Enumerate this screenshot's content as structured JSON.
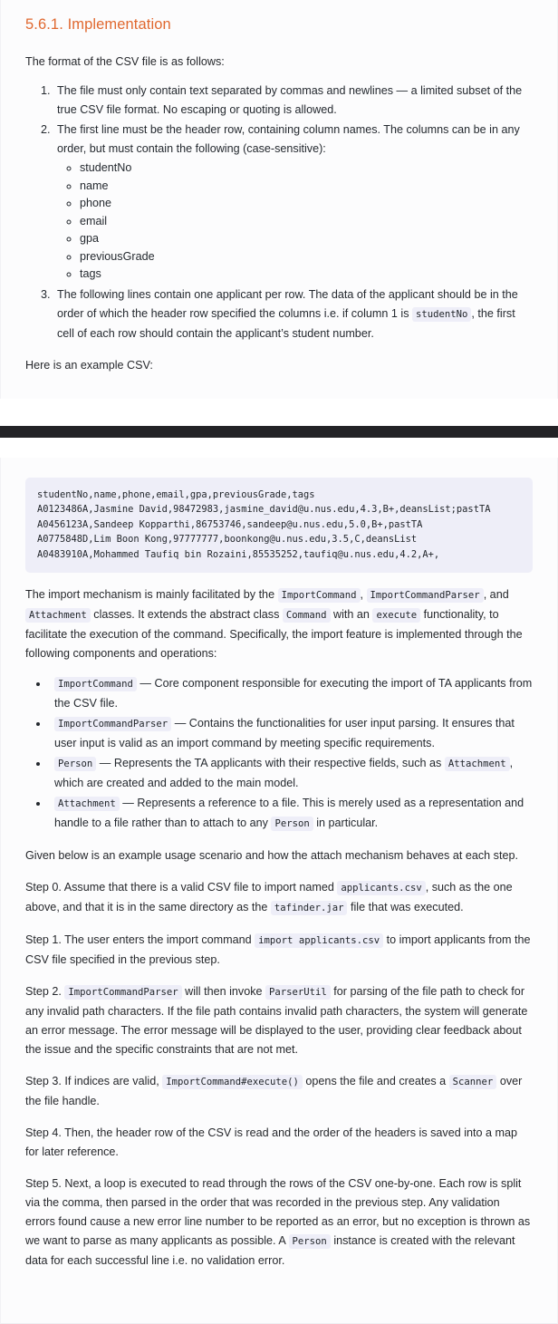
{
  "heading": "5.6.1. Implementation",
  "intro": "The format of the CSV file is as follows:",
  "rules": {
    "rule1": "The file must only contain text separated by commas and newlines — a limited subset of the true CSV file format. No escaping or quoting is allowed.",
    "rule2_lead": "The first line must be the header row, containing column names. The columns can be in any order, but must contain the following (case-sensitive):",
    "columns": [
      "studentNo",
      "name",
      "phone",
      "email",
      "gpa",
      "previousGrade",
      "tags"
    ],
    "rule3_a": "The following lines contain one applicant per row. The data of the applicant should be in the order of which the header row specified the columns i.e. if column 1 is",
    "rule3_code": "studentNo",
    "rule3_b": ", the first cell of each row should contain the applicant’s student number."
  },
  "example_lead": "Here is an example CSV:",
  "csv": {
    "line0": "studentNo,name,phone,email,gpa,previousGrade,tags",
    "line1": "A0123486A,Jasmine David,98472983,jasmine_david@u.nus.edu,4.3,B+,deansList;pastTA",
    "line2": "A0456123A,Sandeep Kopparthi,86753746,sandeep@u.nus.edu,5.0,B+,pastTA",
    "line3": "A0775848D,Lim Boon Kong,97777777,boonkong@u.nus.edu,3.5,C,deansList",
    "line4": "A0483910A,Mohammed Taufiq bin Rozaini,85535252,taufiq@u.nus.edu,4.2,A+,"
  },
  "mechanism": {
    "p1_a": "The import mechanism is mainly facilitated by the",
    "p1_code1": "ImportCommand",
    "p1_b": ",",
    "p1_code2": "ImportCommandParser",
    "p1_c": ", and",
    "p1_code3": "Attachment",
    "p1_d": "classes. It extends the abstract class",
    "p1_code4": "Command",
    "p1_e": "with an",
    "p1_code5": "execute",
    "p1_f": "functionality, to facilitate the execution of the command. Specifically, the import feature is implemented through the following components and operations:"
  },
  "components": [
    {
      "code": "ImportCommand",
      "text_a": "— Core component responsible for executing the import of TA applicants from the CSV file."
    },
    {
      "code": "ImportCommandParser",
      "text_a": "— Contains the functionalities for user input parsing. It ensures that user input is valid as an import command by meeting specific requirements."
    },
    {
      "code": "Person",
      "text_a": "— Represents the TA applicants with their respective fields, such as",
      "code2": "Attachment",
      "text_b": ", which are created and added to the main model."
    },
    {
      "code": "Attachment",
      "text_a": "— Represents a reference to a file. This is merely used as a representation and handle to a file rather than to attach to any",
      "code2": "Person",
      "text_b": "in particular."
    }
  ],
  "scenario_lead": "Given below is an example usage scenario and how the attach mechanism behaves at each step.",
  "steps": {
    "step0_a": "Step 0. Assume that there is a valid CSV file to import named",
    "step0_code1": "applicants.csv",
    "step0_b": ", such as the one above, and that it is in the same directory as the",
    "step0_code2": "tafinder.jar",
    "step0_c": "file that was executed.",
    "step1_a": "Step 1. The user enters the import command",
    "step1_code1": "import applicants.csv",
    "step1_b": "to import applicants from the CSV file specified in the previous step.",
    "step2_a": "Step 2.",
    "step2_code1": "ImportCommandParser",
    "step2_b": "will then invoke",
    "step2_code2": "ParserUtil",
    "step2_c": "for parsing of the file path to check for any invalid path characters. If the file path contains invalid path characters, the system will generate an error message. The error message will be displayed to the user, providing clear feedback about the issue and the specific constraints that are not met.",
    "step3_a": "Step 3. If indices are valid,",
    "step3_code1": "ImportCommand#execute()",
    "step3_b": "opens the file and creates a",
    "step3_code2": "Scanner",
    "step3_c": "over the file handle.",
    "step4": "Step 4. Then, the header row of the CSV is read and the order of the headers is saved into a map for later reference.",
    "step5_a": "Step 5. Next, a loop is executed to read through the rows of the CSV one-by-one. Each row is split via the comma, then parsed in the order that was recorded in the previous step. Any validation errors found cause a new error line number to be reported as an error, but no exception is thrown as we want to parse as many applicants as possible. A",
    "step5_code1": "Person",
    "step5_b": "instance is created with the relevant data for each successful line i.e. no validation error."
  }
}
